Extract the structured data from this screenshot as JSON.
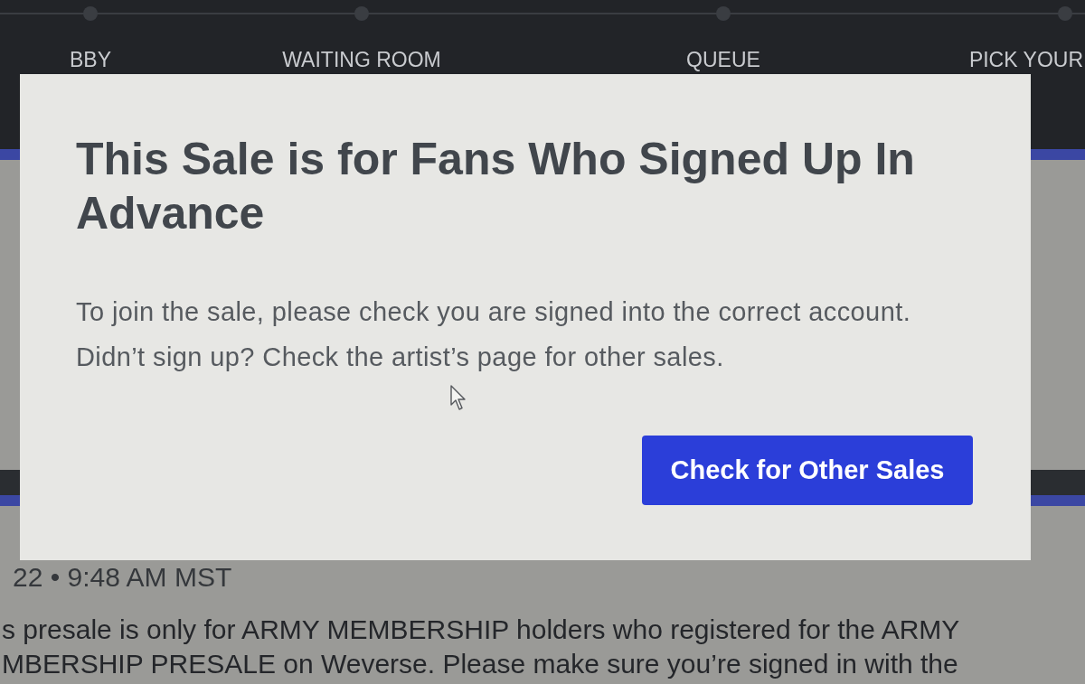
{
  "stepper": {
    "steps": [
      {
        "label": "BBY"
      },
      {
        "label": "WAITING ROOM"
      },
      {
        "label": "QUEUE"
      },
      {
        "label": "PICK YOUR"
      }
    ]
  },
  "page": {
    "timestamp": "22 • 9:48 AM MST",
    "notice_lines": [
      "s presale is only for ARMY MEMBERSHIP holders who registered for the ARMY",
      "MBERSHIP PRESALE on Weverse. Please make sure you’re signed in with the"
    ]
  },
  "modal": {
    "title": "This Sale is for Fans Who Signed Up In Advance",
    "message_lines": [
      "To join the sale, please check you are signed into the correct account.",
      "Didn’t sign up? Check the artist’s page for other sales."
    ],
    "button": "Check for Other Sales"
  }
}
